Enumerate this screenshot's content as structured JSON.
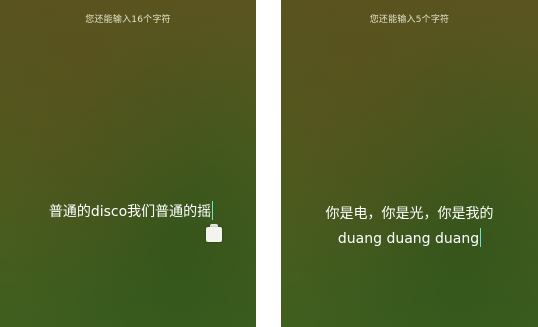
{
  "left_panel": {
    "counter_text": "您还能输入16个字符",
    "input_text": "普通的disco我们普通的摇"
  },
  "right_panel": {
    "counter_text": "您还能输入5个字符",
    "input_line1": "你是电，你是光，你是我的",
    "input_line2": "duang duang duang"
  },
  "colors": {
    "background_top": "#5a5420",
    "background_bottom": "#3f5f1f",
    "caret": "#6fe3c8",
    "text": "#ffffff"
  }
}
